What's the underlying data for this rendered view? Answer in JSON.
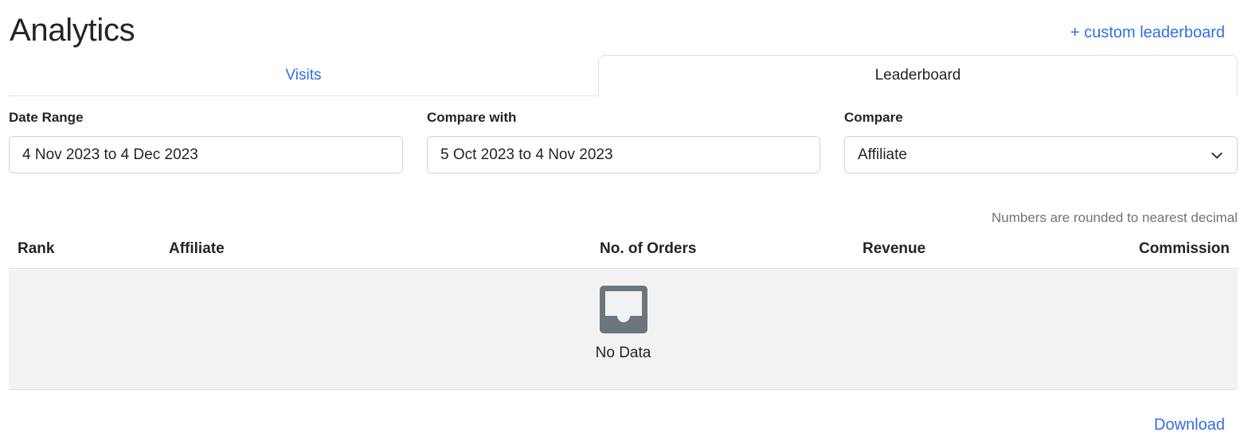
{
  "page": {
    "title": "Analytics",
    "custom_leaderboard_link": "+ custom leaderboard"
  },
  "tabs": [
    {
      "label": "Visits",
      "active": false
    },
    {
      "label": "Leaderboard",
      "active": true
    }
  ],
  "filters": {
    "date_range": {
      "label": "Date Range",
      "value": "4 Nov 2023 to 4 Dec 2023"
    },
    "compare_with": {
      "label": "Compare with",
      "value": "5 Oct 2023 to 4 Nov 2023"
    },
    "compare": {
      "label": "Compare",
      "value": "Affiliate",
      "icon": "chevron-down-icon"
    }
  },
  "note": "Numbers are rounded to nearest decimal",
  "table": {
    "columns": [
      "Rank",
      "Affiliate",
      "No. of Orders",
      "Revenue",
      "Commission"
    ],
    "rows": [],
    "empty_text": "No Data",
    "empty_icon": "inbox-icon"
  },
  "download_label": "Download",
  "colors": {
    "link": "#2f6fe0",
    "empty_bg": "#f2f2f2",
    "icon": "#6c757d"
  }
}
